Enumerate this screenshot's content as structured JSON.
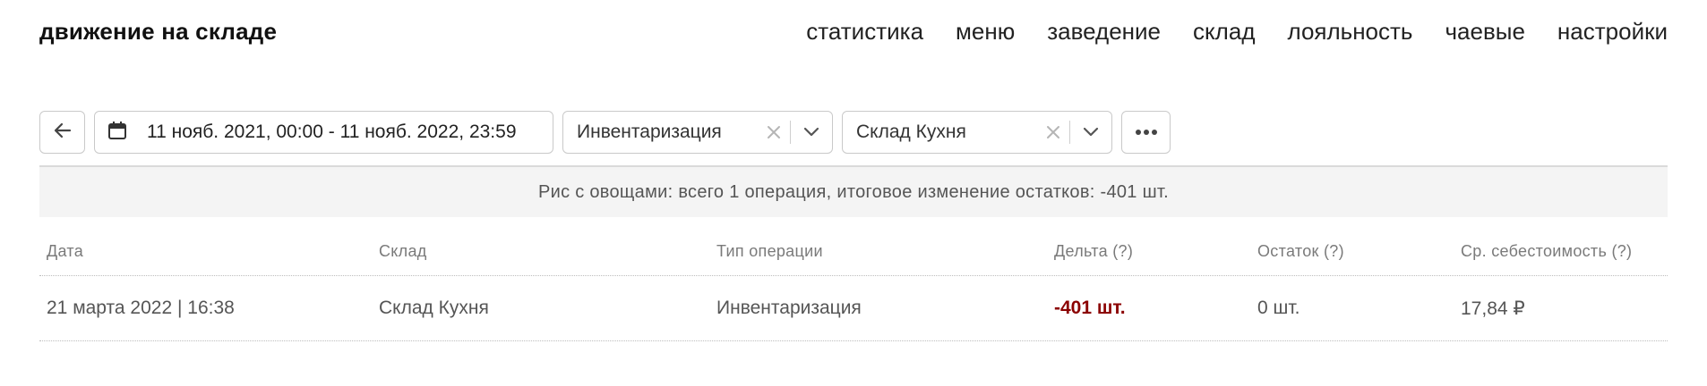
{
  "header": {
    "title": "движение на складе",
    "nav": [
      "статистика",
      "меню",
      "заведение",
      "склад",
      "лояльность",
      "чаевые",
      "настройки"
    ]
  },
  "toolbar": {
    "date_range": "11 нояб. 2021, 00:00 - 11 нояб. 2022, 23:59",
    "filter_operation": "Инвентаризация",
    "filter_storage": "Склад Кухня"
  },
  "summary": "Рис с овощами: всего 1 операция, итоговое изменение остатков: -401 шт.",
  "table": {
    "columns": [
      "Дата",
      "Склад",
      "Тип операции",
      "Дельта (?)",
      "Остаток (?)",
      "Ср. себестоимость (?)"
    ],
    "rows": [
      [
        "21 марта 2022 | 16:38",
        "Склад Кухня",
        "Инвентаризация",
        "-401 шт.",
        "0 шт.",
        "17,84 ₽"
      ]
    ]
  },
  "colors": {
    "delta_negative": "#8b0000",
    "summary_bg": "#f4f4f4"
  },
  "icons": [
    "arrow-left-icon",
    "calendar-icon",
    "close-icon",
    "chevron-down-icon",
    "more-dots-icon"
  ]
}
